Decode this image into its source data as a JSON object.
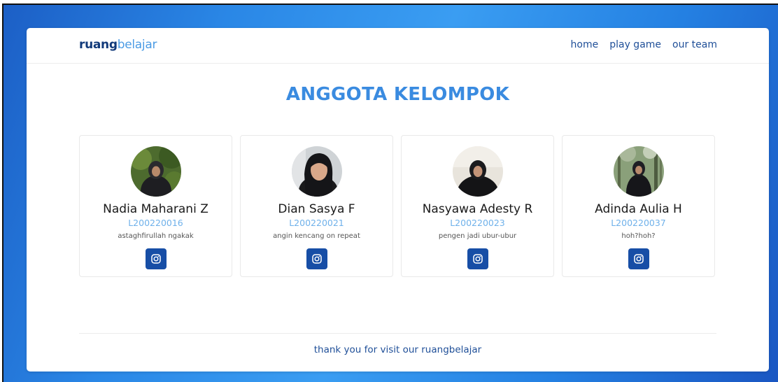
{
  "navbar": {
    "brand_part1": "ruang",
    "brand_part2": "belajar",
    "links": [
      "home",
      "play game",
      "our team"
    ]
  },
  "heading": "ANGGOTA KELOMPOK",
  "members": [
    {
      "name": "Nadia Maharani Z",
      "id": "L200220016",
      "quote": "astaghfirullah ngakak",
      "icon": "instagram-icon"
    },
    {
      "name": "Dian Sasya F",
      "id": "L200220021",
      "quote": "angin kencang on repeat",
      "icon": "instagram-icon"
    },
    {
      "name": "Nasyawa Adesty R",
      "id": "L200220023",
      "quote": "pengen jadi ubur-ubur",
      "icon": "instagram-icon"
    },
    {
      "name": "Adinda Aulia H",
      "id": "L200220037",
      "quote": "hoh?hoh?",
      "icon": "instagram-icon"
    }
  ],
  "footer": "thank you for visit our ruangbelajar",
  "colors": {
    "accent": "#3a8be0",
    "nav_text": "#1f4f98",
    "instagram_button": "#174ea6",
    "id_text": "#6fb1ea"
  }
}
